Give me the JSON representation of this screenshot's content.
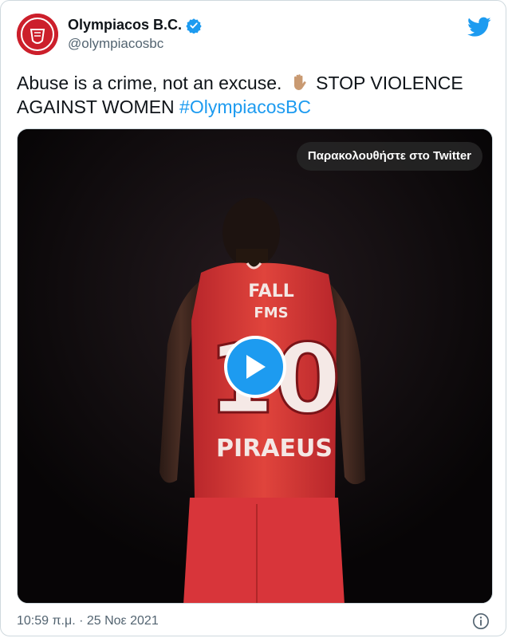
{
  "tweet": {
    "display_name": "Olympiacos B.C.",
    "handle": "@olympiacosbc",
    "verified": true,
    "text_part1": "Abuse is a crime, not an excuse.",
    "emoji": "raised-hand",
    "text_part2": "STOP VIOLENCE AGAINST WOMEN",
    "hashtag": "#OlympiacosBC",
    "timestamp": "10:59 π.μ. · 25 Νοε 2021"
  },
  "media": {
    "watch_label": "Παρακολουθήστε στο Twitter",
    "jersey": {
      "name": "FALL",
      "sponsor": "FMS",
      "number": "10",
      "team_text": "PIRAEUS"
    }
  },
  "colors": {
    "brand_red": "#cc1f2b",
    "twitter_blue": "#1d9bf0",
    "secondary_text": "#536471"
  }
}
